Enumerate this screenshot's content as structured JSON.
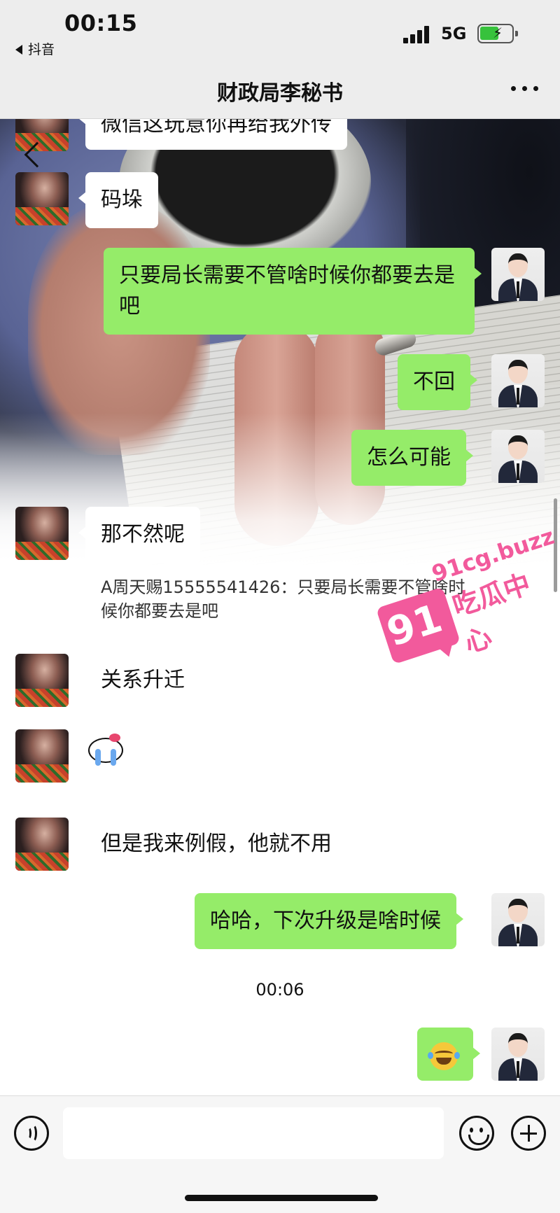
{
  "status_bar": {
    "time": "00:15",
    "back_app": "抖音",
    "network": "5G"
  },
  "nav": {
    "title": "财政局李秘书"
  },
  "messages": [
    {
      "side": "left",
      "text": "微信这玩意你再给我外传"
    },
    {
      "side": "left",
      "text": "码垛"
    },
    {
      "side": "right",
      "text": "只要局长需要不管啥时候你都要去是吧"
    },
    {
      "side": "right",
      "text": "不回"
    },
    {
      "side": "right",
      "text": "怎么可能"
    },
    {
      "side": "left",
      "text": "那不然呢"
    },
    {
      "side": "left",
      "type": "quote",
      "text": "A周天赐15555541426：只要局长需要不管啥时候你都要去是吧"
    },
    {
      "side": "left",
      "text": "关系升迁"
    },
    {
      "side": "left",
      "type": "sticker",
      "sticker": "hello-kitty-crying"
    },
    {
      "side": "left",
      "text": "但是我来例假，他就不用"
    },
    {
      "side": "right",
      "text": "哈哈，下次升级是啥时候"
    },
    {
      "type": "timestamp",
      "text": "00:06"
    },
    {
      "side": "right",
      "type": "emoji",
      "emoji": "laughing-tears"
    }
  ],
  "watermark": {
    "number": "91",
    "url": "91cg.buzz",
    "text": "吃瓜中心",
    "color": "#f25a9c"
  },
  "input": {
    "placeholder": ""
  },
  "colors": {
    "bubble_right": "#95ec69",
    "bubble_left": "#ffffff",
    "nav_bg": "#ededed"
  }
}
